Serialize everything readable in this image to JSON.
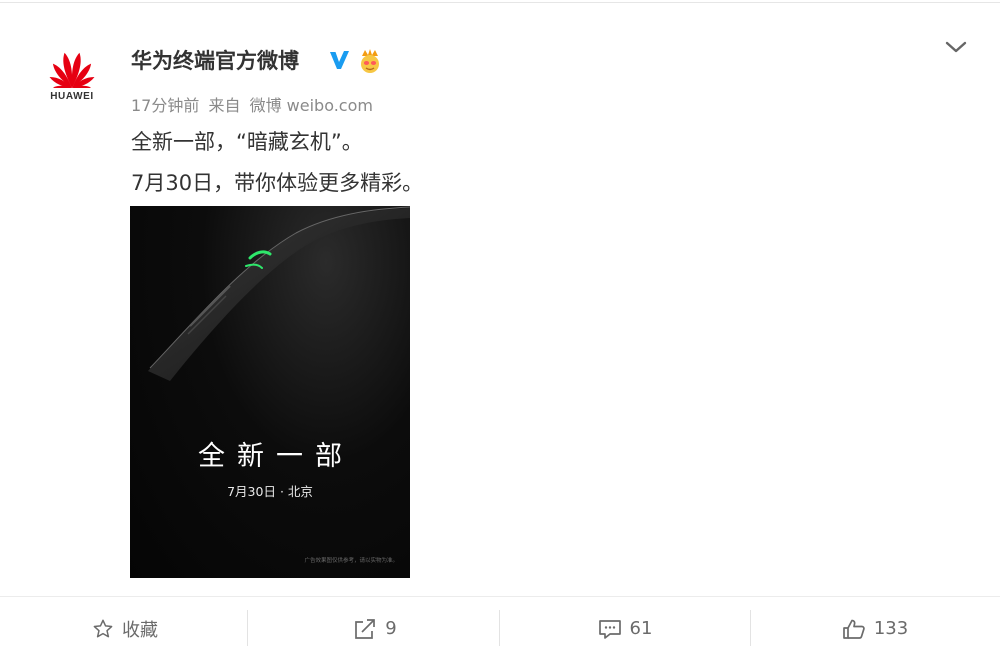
{
  "post": {
    "author": {
      "logo_text": "HUAWEI",
      "name": "华为终端官方微博",
      "verified_icon": "verified-v-icon",
      "badge_icon": "vip-emoji-icon"
    },
    "meta": {
      "time": "17分钟前",
      "source_prefix": "来自",
      "source": "微博 weibo.com"
    },
    "text_lines": [
      "全新一部，“暗藏玄机”。",
      "7月30日，带你体验更多精彩。"
    ],
    "poster": {
      "headline": "全新一部",
      "date_line": "7月30日 · 北京",
      "fine_print": "广告效果图仅供参考，请以实物为准。"
    }
  },
  "actions": {
    "favorite_label": "收藏",
    "repost_count": "9",
    "comment_count": "61",
    "like_count": "133"
  },
  "colors": {
    "huawei_red": "#e60012",
    "verified_blue": "#1a9cf0",
    "text": "#333333",
    "muted": "#8a8a8a"
  }
}
